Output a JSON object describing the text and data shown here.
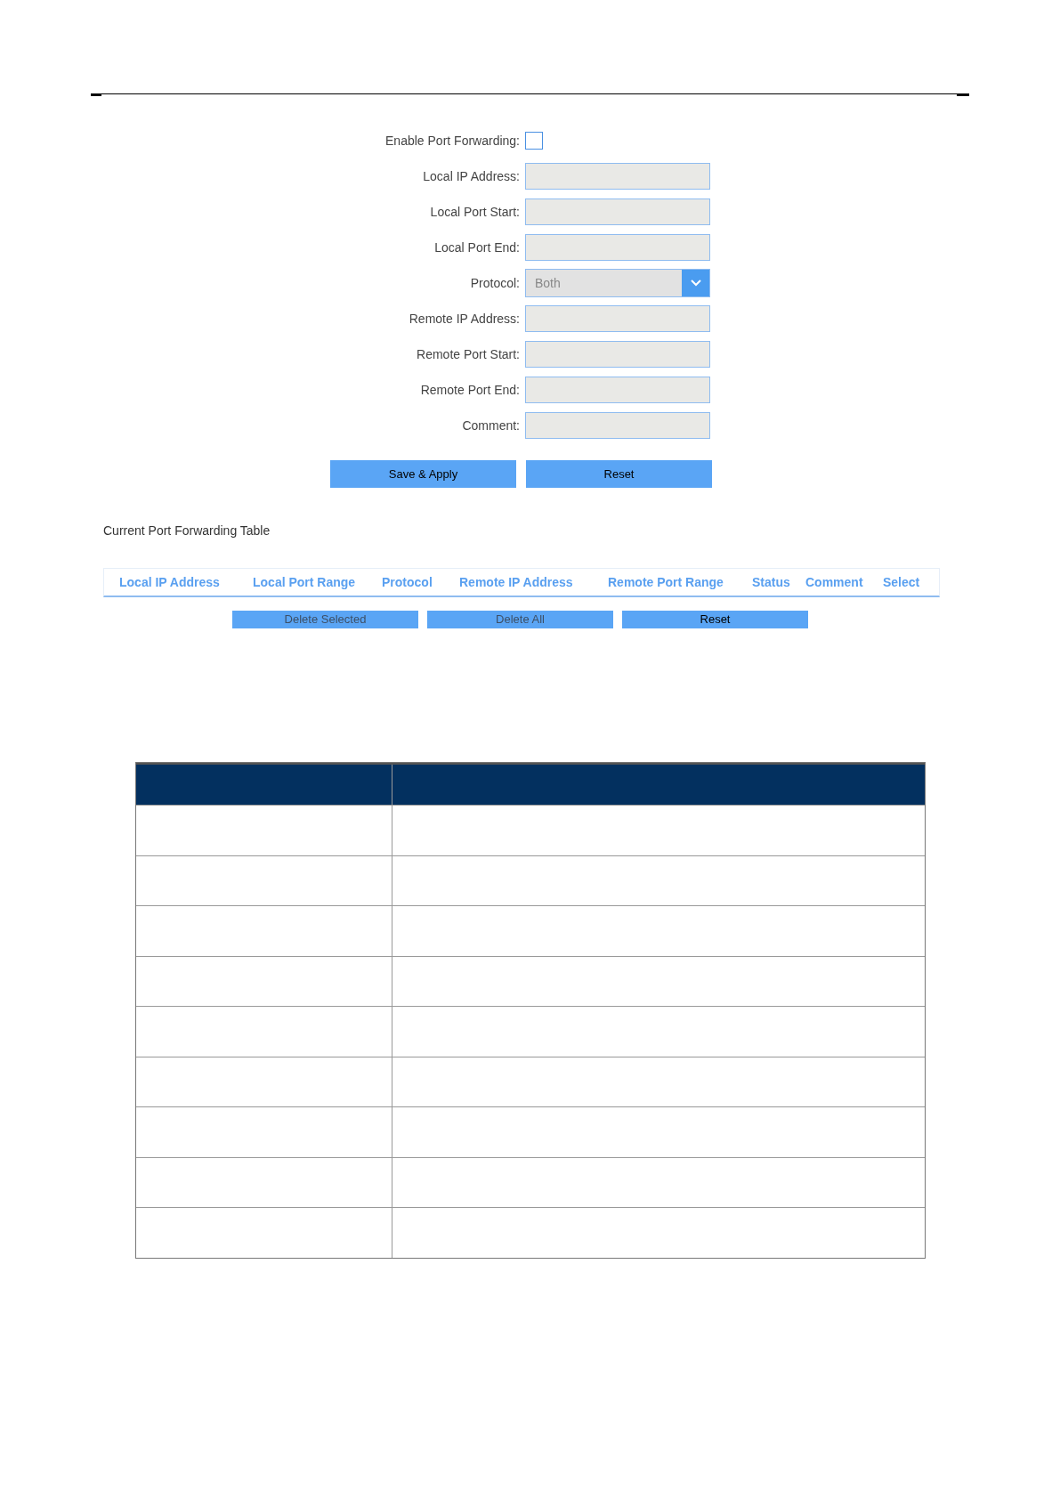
{
  "form": {
    "enable": {
      "label": "Enable Port Forwarding:",
      "checked": false
    },
    "fields": [
      {
        "kind": "text",
        "label": "Local IP Address:"
      },
      {
        "kind": "text",
        "label": "Local Port Start:"
      },
      {
        "kind": "text",
        "label": "Local Port End:"
      },
      {
        "kind": "select",
        "label": "Protocol:",
        "value": "Both"
      },
      {
        "kind": "text",
        "label": "Remote IP Address:"
      },
      {
        "kind": "text",
        "label": "Remote Port Start:"
      },
      {
        "kind": "text",
        "label": "Remote Port End:"
      },
      {
        "kind": "text",
        "label": "Comment:"
      }
    ],
    "buttons": [
      {
        "label": "Save & Apply",
        "disabled": false
      },
      {
        "label": "Reset",
        "disabled": false
      }
    ]
  },
  "table": {
    "title": "Current Port Forwarding Table",
    "columns": [
      "Local IP Address",
      "Local Port Range",
      "Protocol",
      "Remote IP Address",
      "Remote Port Range",
      "Status",
      "Comment",
      "Select"
    ],
    "buttons": [
      {
        "label": "Delete Selected",
        "disabled": true
      },
      {
        "label": "Delete All",
        "disabled": true
      },
      {
        "label": "Reset",
        "disabled": false
      }
    ]
  }
}
